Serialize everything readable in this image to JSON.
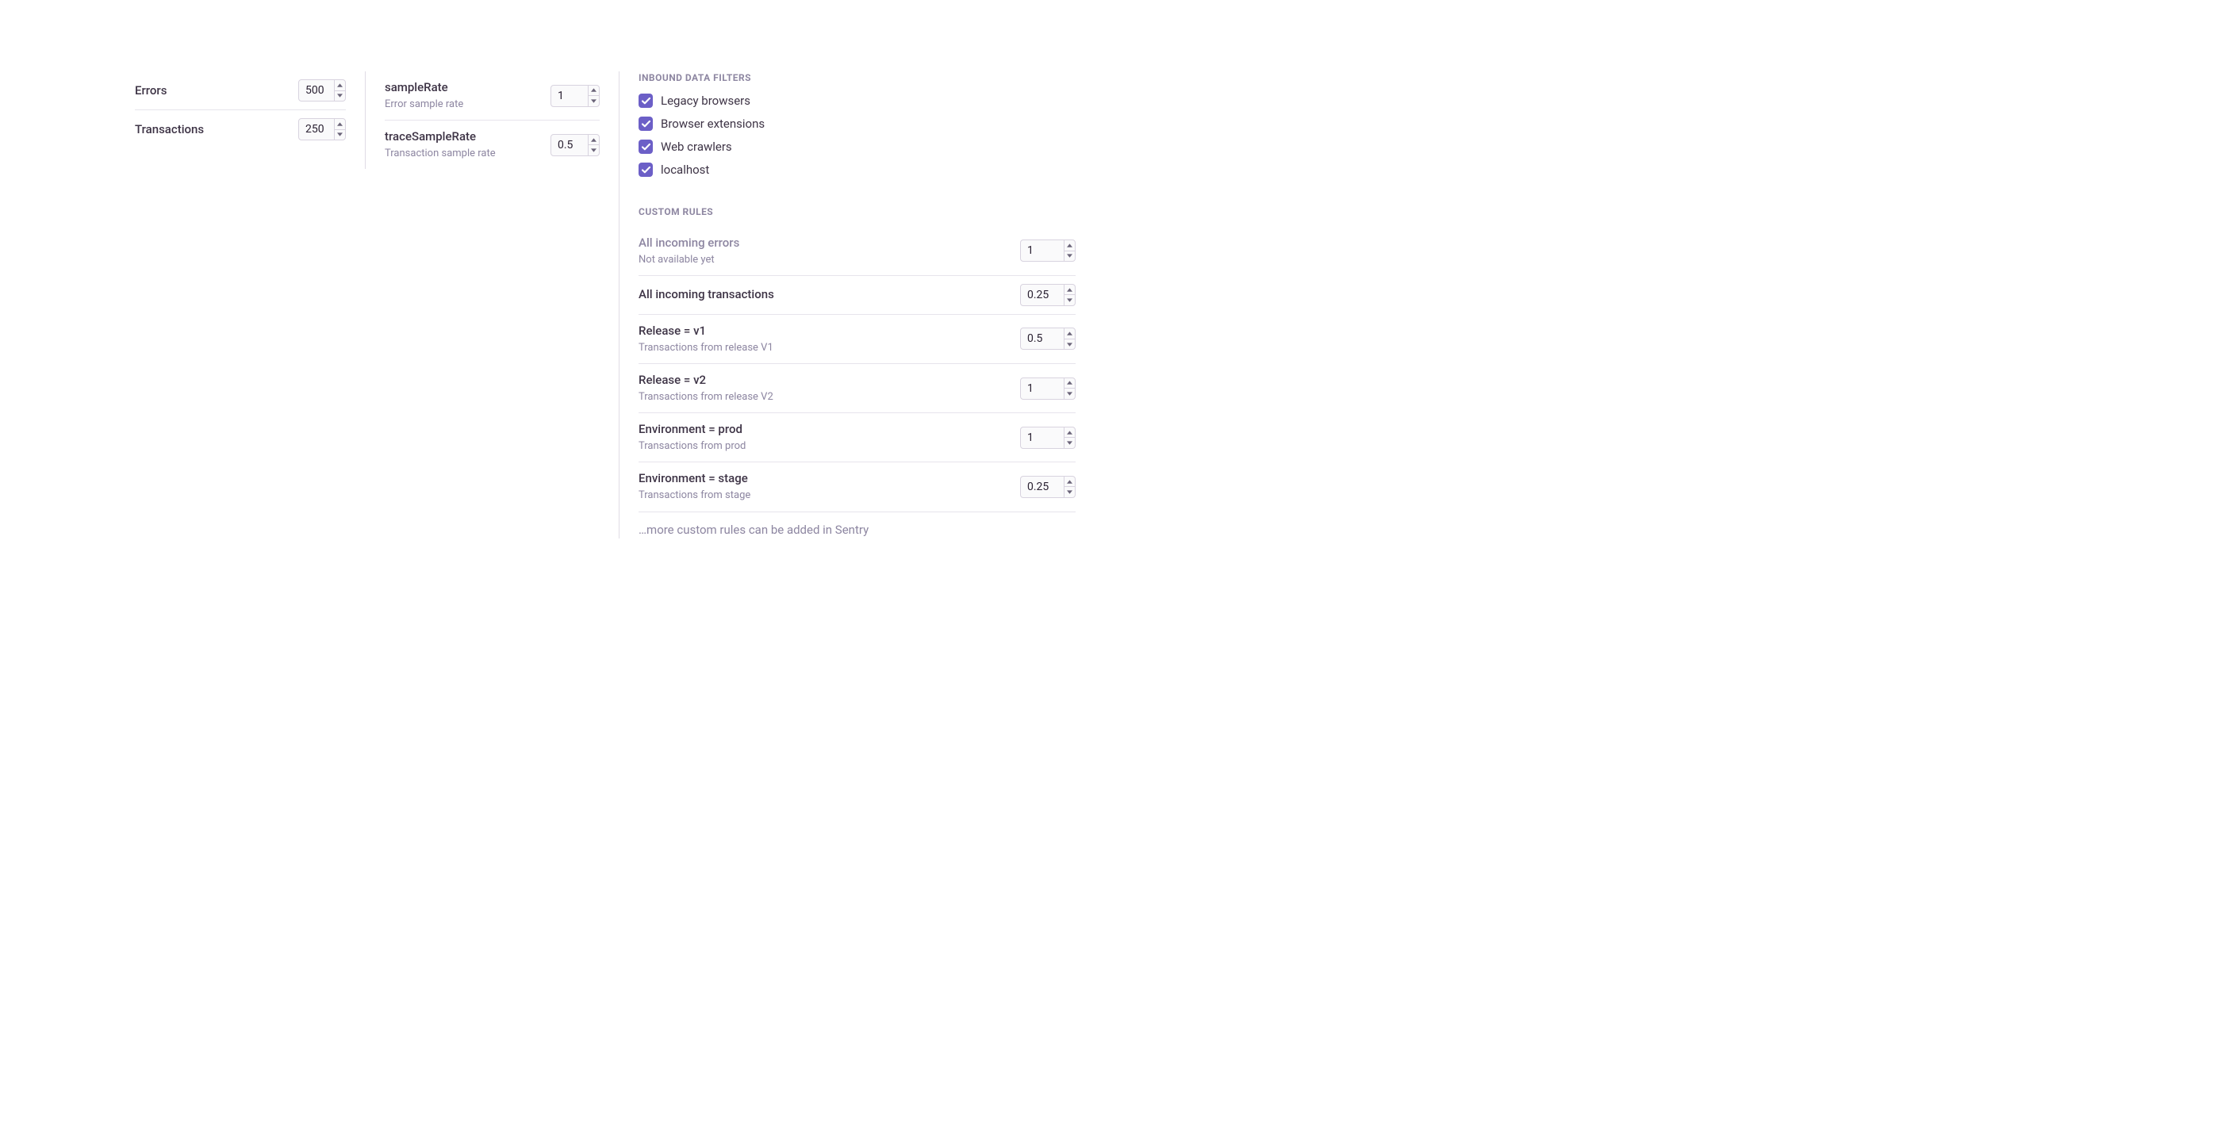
{
  "col1": {
    "rows": [
      {
        "label": "Errors",
        "value": "500"
      },
      {
        "label": "Transactions",
        "value": "250"
      }
    ]
  },
  "col2": {
    "rows": [
      {
        "label": "sampleRate",
        "sub": "Error sample rate",
        "value": "1"
      },
      {
        "label": "traceSampleRate",
        "sub": "Transaction sample rate",
        "value": "0.5"
      }
    ]
  },
  "col3": {
    "filters_header": "INBOUND DATA FILTERS",
    "filters": [
      {
        "label": "Legacy browsers",
        "checked": true
      },
      {
        "label": "Browser extensions",
        "checked": true
      },
      {
        "label": "Web crawlers",
        "checked": true
      },
      {
        "label": "localhost",
        "checked": true
      }
    ],
    "rules_header": "CUSTOM RULES",
    "rules": [
      {
        "label": "All incoming errors",
        "sub": "Not available yet",
        "value": "1",
        "disabled": true
      },
      {
        "label": "All incoming transactions",
        "sub": "",
        "value": "0.25",
        "disabled": false
      },
      {
        "label": "Release = v1",
        "sub": "Transactions from release V1",
        "value": "0.5",
        "disabled": false
      },
      {
        "label": "Release = v2",
        "sub": "Transactions from release V2",
        "value": "1",
        "disabled": false
      },
      {
        "label": "Environment = prod",
        "sub": "Transactions from prod",
        "value": "1",
        "disabled": false
      },
      {
        "label": "Environment = stage",
        "sub": "Transactions from stage",
        "value": "0.25",
        "disabled": false
      }
    ],
    "more_text": "…more custom rules can be added in Sentry"
  }
}
